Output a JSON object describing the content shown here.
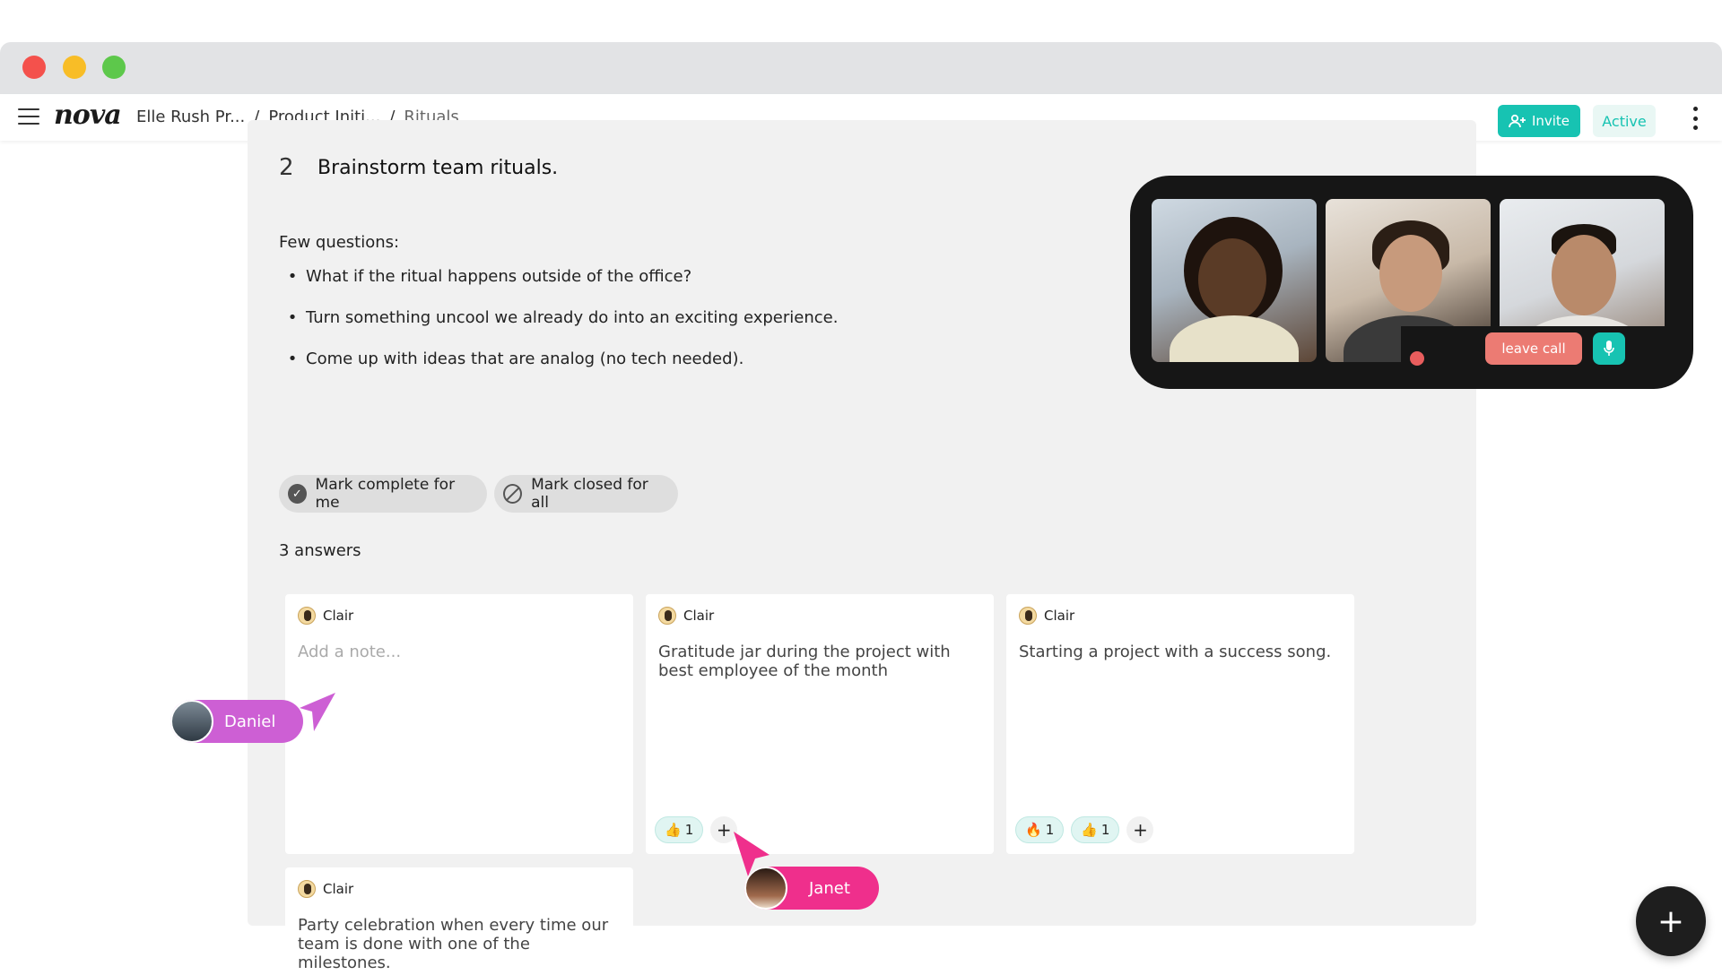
{
  "app": {
    "logo_text": "nova",
    "breadcrumb": [
      "Elle Rush Pr...",
      "Product Initi...",
      "Rituals"
    ],
    "invite_label": "Invite",
    "status_label": "Active"
  },
  "task": {
    "number": "2",
    "title": "Brainstorm team rituals.",
    "questions_label": "Few questions:",
    "questions": [
      "What if the ritual happens outside of the office?",
      "Turn something uncool we already do into an exciting experience.",
      "Come up with ideas that are analog (no tech needed)."
    ],
    "mark_complete_label": "Mark complete for me",
    "mark_closed_label": "Mark closed for all",
    "answers_count": "3 answers"
  },
  "cards": [
    {
      "author": "Clair",
      "placeholder": "Add a note...",
      "text": ""
    },
    {
      "author": "Clair",
      "text": "Gratitude jar during the project with best employee of the month",
      "reactions": [
        {
          "emoji": "👍",
          "count": "1"
        }
      ]
    },
    {
      "author": "Clair",
      "text": "Starting a project with a success song.",
      "reactions": [
        {
          "emoji": "🔥",
          "count": "1"
        },
        {
          "emoji": "👍",
          "count": "1"
        }
      ]
    },
    {
      "author": "Clair",
      "text": "Party celebration when every time our team is done with one of the milestones."
    }
  ],
  "add_reaction_symbol": "+",
  "call": {
    "leave_label": "leave call"
  },
  "cursors": [
    {
      "name": "Daniel",
      "color": "#cd5fd4"
    },
    {
      "name": "Janet",
      "color": "#ef2f8c"
    }
  ],
  "fab_symbol": "+",
  "colors": {
    "accent": "#17c3b2",
    "leave": "#ec7b73"
  }
}
